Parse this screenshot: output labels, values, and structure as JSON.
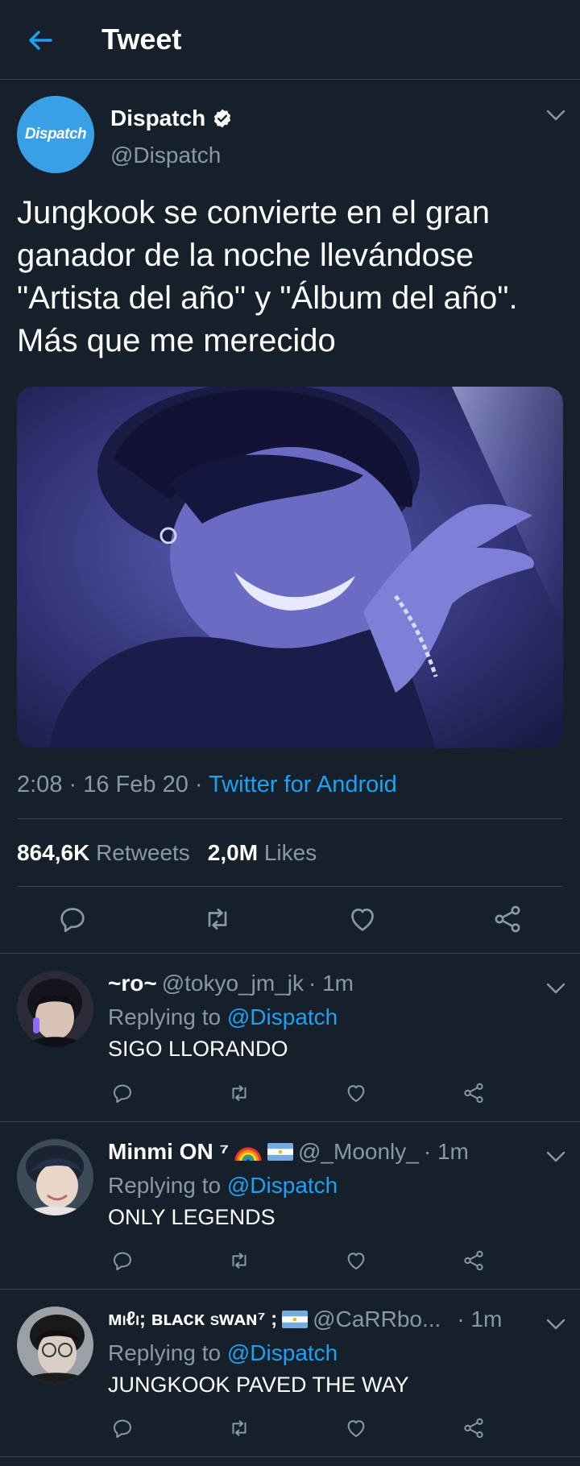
{
  "header": {
    "title": "Tweet",
    "back_icon": "arrow-left-icon"
  },
  "tweet": {
    "avatar_text": "Dispatch",
    "name": "Dispatch",
    "handle": "@Dispatch",
    "text": "Jungkook se convierte en el gran ganador de la noche llevándose \"Artista del año\" y \"Álbum del año\". Más que me merecido",
    "time": "2:08",
    "date": "16 Feb 20",
    "source": "Twitter for Android",
    "retweets_count": "864,6K",
    "retweets_label": "Retweets",
    "likes_count": "2,0M",
    "likes_label": "Likes"
  },
  "replies": [
    {
      "name": "~ro~",
      "handle": "@tokyo_jm_jk",
      "time": "· 1m",
      "replying_label": "Replying to",
      "mention": "@Dispatch",
      "text": "SIGO LLORANDO"
    },
    {
      "name": "Minmi ON ⁷",
      "handle": "@_Moonly_",
      "time": "· 1m",
      "replying_label": "Replying to",
      "mention": "@Dispatch",
      "text": "ONLY LEGENDS"
    },
    {
      "name": "ᴍɩℓɩ; ʙʟᴀᴄᴋ sᴡᴀɴ⁷ ;",
      "handle": "@CaRRbo...",
      "time": "· 1m",
      "replying_label": "Replying to",
      "mention": "@Dispatch",
      "text": "JUNGKOOK PAVED THE WAY"
    }
  ],
  "colors": {
    "background": "#15202b",
    "accent": "#1da1f2",
    "muted": "#8899a6",
    "border": "#38444d"
  },
  "icons": [
    "reply-icon",
    "retweet-icon",
    "like-icon",
    "share-icon",
    "chevron-down-icon",
    "verified-badge-icon"
  ]
}
